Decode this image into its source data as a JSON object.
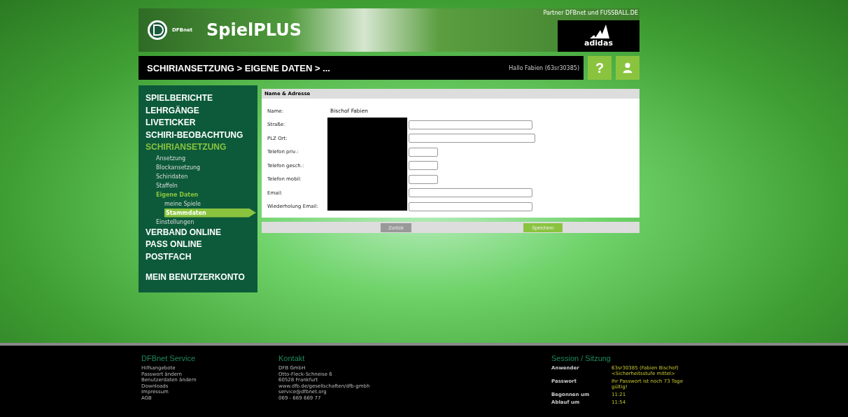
{
  "header": {
    "logo_text": "DFBnet",
    "title": "SpielPLUS",
    "partner": "Partner DFBnet und FUSSBALL.DE",
    "sponsor": "adidas"
  },
  "breadcrumb": {
    "path": "SCHIRIANSETZUNG > EIGENE DATEN > ...",
    "greeting": "Hallo Fabien (63sr30385)",
    "help": "?"
  },
  "nav": [
    {
      "label": "SPIELBERICHTE",
      "active": false
    },
    {
      "label": "LEHRGÄNGE",
      "active": false
    },
    {
      "label": "LIVETICKER",
      "active": false
    },
    {
      "label": "SCHIRI-BEOBACHTUNG",
      "active": false
    },
    {
      "label": "SCHIRIANSETZUNG",
      "active": true,
      "children": [
        {
          "label": "Ansetzung",
          "active": false
        },
        {
          "label": "Blockansetzung",
          "active": false
        },
        {
          "label": "Schiridaten",
          "active": false
        },
        {
          "label": "Staffeln",
          "active": false
        },
        {
          "label": "Eigene Daten",
          "active": true,
          "children": [
            {
              "label": "meine Spiele",
              "selected": false
            },
            {
              "label": "Stammdaten",
              "selected": true
            }
          ]
        },
        {
          "label": "Einstellungen",
          "active": false
        }
      ]
    },
    {
      "label": "VERBAND ONLINE",
      "active": false
    },
    {
      "label": "PASS ONLINE",
      "active": false
    },
    {
      "label": "POSTFACH",
      "active": false
    }
  ],
  "nav_bottom": [
    {
      "label": "MEIN BENUTZERKONTO",
      "active": false
    }
  ],
  "form": {
    "title": "Name & Adresse",
    "rows": [
      {
        "label": "Name:",
        "kind": "text",
        "value": "Bischof Fabien"
      },
      {
        "label": "Straße:",
        "kind": "wide"
      },
      {
        "label": "PLZ Ort:",
        "kind": "wider"
      },
      {
        "label": "Telefon priv.:",
        "kind": "narrow"
      },
      {
        "label": "Telefon gesch.:",
        "kind": "narrow"
      },
      {
        "label": "Telefon mobil:",
        "kind": "narrow"
      },
      {
        "label": "Email:",
        "kind": "wide"
      },
      {
        "label": "Wiederholung Email:",
        "kind": "wide"
      }
    ],
    "back": "Zurück",
    "save": "Speichern"
  },
  "footer": {
    "service": {
      "title": "DFBnet Service",
      "links": [
        "Hilfsangebote",
        "Passwort ändern",
        "Benutzerdaten ändern",
        "Downloads",
        "Impressum",
        "AGB"
      ]
    },
    "contact": {
      "title": "Kontakt",
      "lines": [
        "DFB GmbH",
        "Otto-Fleck-Schneise 6",
        "60528 Frankfurt",
        "www.dfb.de/gesellschaften/dfb-gmbh",
        "service@dfbnet.org",
        "069 - 669 669 77"
      ]
    },
    "session": {
      "title": "Session / Sitzung",
      "rows": [
        {
          "label": "Anwender",
          "value": "63sr30385 (Fabien Bischof)\n<Sicherheitsstufe mittel>"
        },
        {
          "label": "Passwort",
          "value": "Ihr Passwort ist noch 73 Tage gültig!"
        },
        {
          "label": "Begonnen um",
          "value": "11:21"
        },
        {
          "label": "Ablauf um",
          "value": "11:54"
        }
      ]
    }
  }
}
